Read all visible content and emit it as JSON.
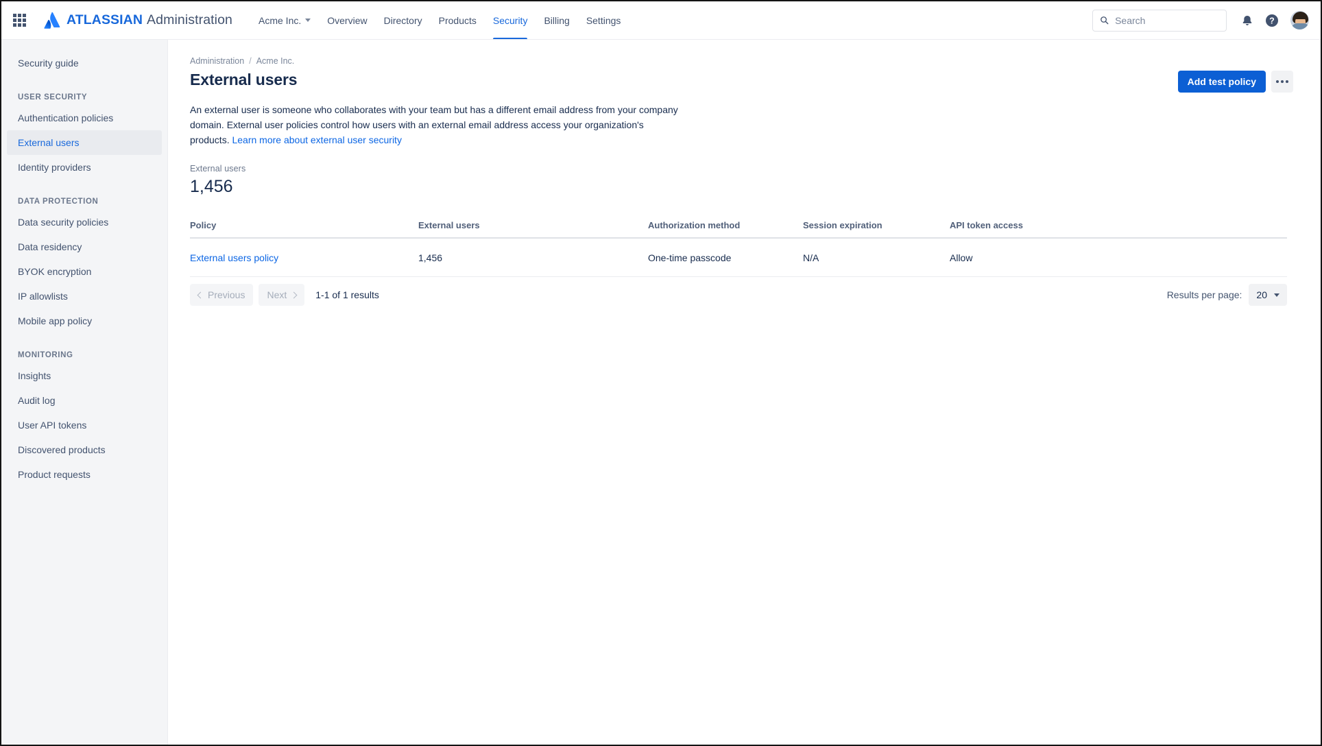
{
  "header": {
    "app_switcher_icon": "grid-icon",
    "brand_bold": "ATLASSIAN",
    "brand_rest": "Administration",
    "org_switcher": "Acme Inc.",
    "nav": [
      {
        "label": "Overview",
        "active": false
      },
      {
        "label": "Directory",
        "active": false
      },
      {
        "label": "Products",
        "active": false
      },
      {
        "label": "Security",
        "active": true
      },
      {
        "label": "Billing",
        "active": false
      },
      {
        "label": "Settings",
        "active": false
      }
    ],
    "search": {
      "placeholder": "Search",
      "value": "",
      "icon": "search-icon"
    },
    "notifications_icon": "bell-icon",
    "help_icon": "question-circle-icon",
    "avatar": "user-avatar"
  },
  "sidebar": {
    "top_item": "Security guide",
    "sections": [
      {
        "heading": "USER SECURITY",
        "items": [
          {
            "label": "Authentication policies",
            "selected": false
          },
          {
            "label": "External users",
            "selected": true
          },
          {
            "label": "Identity providers",
            "selected": false
          }
        ]
      },
      {
        "heading": "DATA PROTECTION",
        "items": [
          {
            "label": "Data security policies",
            "selected": false
          },
          {
            "label": "Data residency",
            "selected": false
          },
          {
            "label": "BYOK encryption",
            "selected": false
          },
          {
            "label": "IP allowlists",
            "selected": false
          },
          {
            "label": "Mobile app policy",
            "selected": false
          }
        ]
      },
      {
        "heading": "MONITORING",
        "items": [
          {
            "label": "Insights",
            "selected": false
          },
          {
            "label": "Audit log",
            "selected": false
          },
          {
            "label": "User API tokens",
            "selected": false
          },
          {
            "label": "Discovered products",
            "selected": false
          },
          {
            "label": "Product requests",
            "selected": false
          }
        ]
      }
    ]
  },
  "main": {
    "breadcrumb": {
      "root": "Administration",
      "separator": "/",
      "current": "Acme Inc."
    },
    "title": "External users",
    "primary_button": "Add test policy",
    "more_button_icon": "ellipsis-icon",
    "description": {
      "text": "An external user is someone who collaborates with your team but has a different email address from your company domain. External user policies control how users with an external email address access your organization's products. ",
      "link": "Learn more about external user security"
    },
    "stat": {
      "label": "External users",
      "value": "1,456"
    },
    "table": {
      "columns": [
        "Policy",
        "External users",
        "Authorization method",
        "Session expiration",
        "API token access"
      ],
      "rows": [
        {
          "policy": "External users policy",
          "external_users": "1,456",
          "authorization_method": "One-time passcode",
          "session_expiration": "N/A",
          "api_token_access": "Allow"
        }
      ]
    },
    "pagination": {
      "previous": "Previous",
      "next": "Next",
      "results": "1-1 of 1 results",
      "per_page_label": "Results per page:",
      "per_page_value": "20"
    }
  },
  "colors": {
    "brand_blue": "#1868db",
    "primary_button": "#0c5fd4",
    "link": "#0c66e4",
    "sidebar_bg": "#f4f5f7",
    "text": "#172b4d"
  }
}
